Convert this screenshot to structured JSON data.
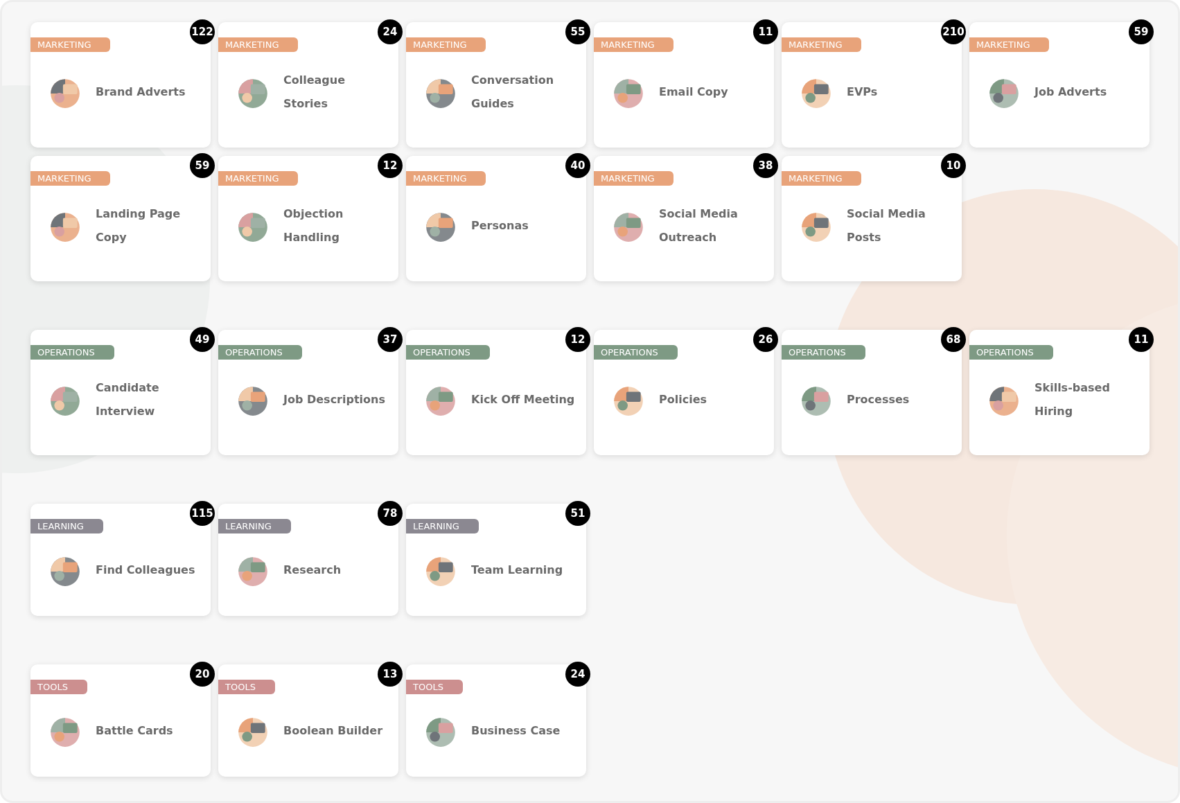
{
  "groups": [
    {
      "color": "#e8a37a",
      "cards": [
        {
          "category": "MARKETING",
          "title": "Brand Adverts",
          "count": "122"
        },
        {
          "category": "MARKETING",
          "title": "Colleague Stories",
          "count": "24"
        },
        {
          "category": "MARKETING",
          "title": "Conversation Guides",
          "count": "55"
        },
        {
          "category": "MARKETING",
          "title": "Email Copy",
          "count": "11"
        },
        {
          "category": "MARKETING",
          "title": "EVPs",
          "count": "210"
        },
        {
          "category": "MARKETING",
          "title": "Job Adverts",
          "count": "59"
        },
        {
          "category": "MARKETING",
          "title": "Landing Page Copy",
          "count": "59"
        },
        {
          "category": "MARKETING",
          "title": "Objection Handling",
          "count": "12"
        },
        {
          "category": "MARKETING",
          "title": "Personas",
          "count": "40"
        },
        {
          "category": "MARKETING",
          "title": "Social Media Outreach",
          "count": "38"
        },
        {
          "category": "MARKETING",
          "title": "Social Media Posts",
          "count": "10"
        }
      ]
    },
    {
      "color": "#7e9a84",
      "cards": [
        {
          "category": "OPERATIONS",
          "title": "Candidate Interview",
          "count": "49"
        },
        {
          "category": "OPERATIONS",
          "title": "Job Descriptions",
          "count": "37"
        },
        {
          "category": "OPERATIONS",
          "title": "Kick Off Meeting",
          "count": "12"
        },
        {
          "category": "OPERATIONS",
          "title": "Policies",
          "count": "26"
        },
        {
          "category": "OPERATIONS",
          "title": "Processes",
          "count": "68"
        },
        {
          "category": "OPERATIONS",
          "title": "Skills-based Hiring",
          "count": "11"
        }
      ]
    },
    {
      "color": "#8b8891",
      "cards": [
        {
          "category": "LEARNING",
          "title": "Find Colleagues",
          "count": "115"
        },
        {
          "category": "LEARNING",
          "title": "Research",
          "count": "78"
        },
        {
          "category": "LEARNING",
          "title": "Team Learning",
          "count": "51"
        }
      ]
    },
    {
      "color": "#cc8f8f",
      "cards": [
        {
          "category": "TOOLS",
          "title": "Battle Cards",
          "count": "20"
        },
        {
          "category": "TOOLS",
          "title": "Boolean Builder",
          "count": "13"
        },
        {
          "category": "TOOLS",
          "title": "Business Case",
          "count": "24"
        }
      ]
    }
  ]
}
